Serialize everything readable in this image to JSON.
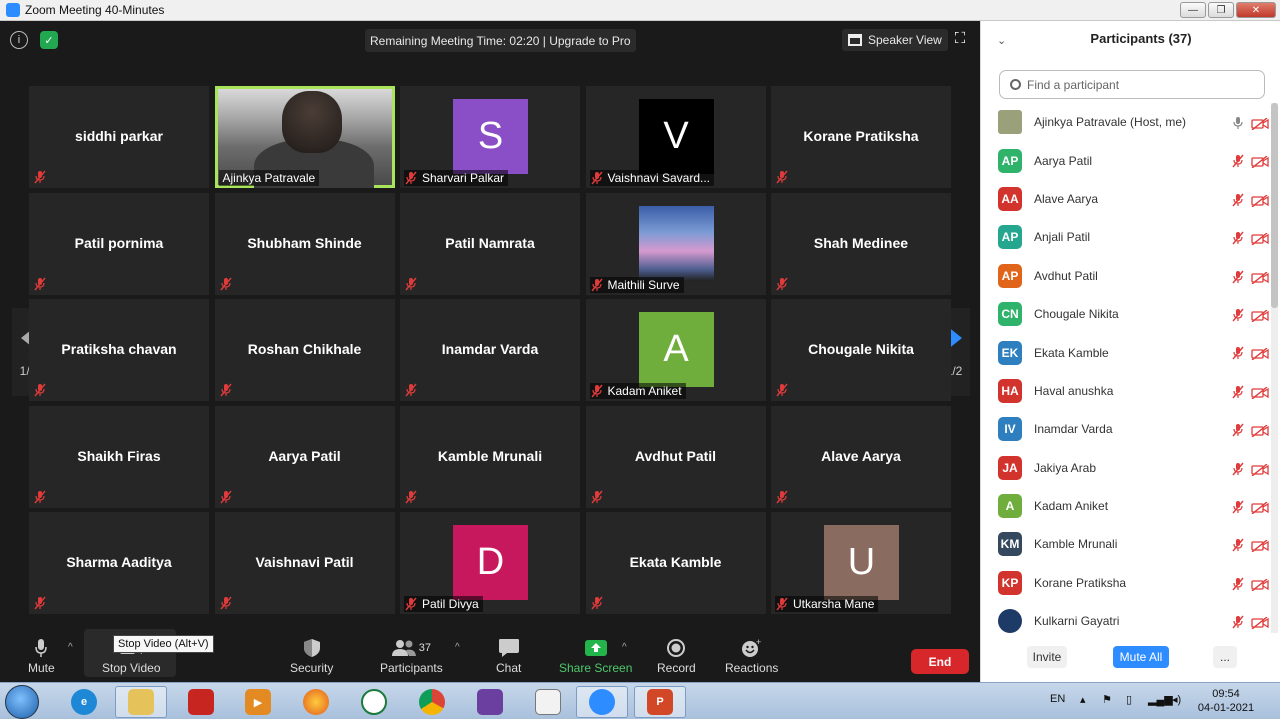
{
  "window": {
    "title": "Zoom Meeting 40-Minutes",
    "minimize": "—",
    "maximize": "❐",
    "close": "✕"
  },
  "topbar": {
    "remaining": "Remaining Meeting Time: 02:20 | Upgrade to Pro",
    "speaker_view": "Speaker View"
  },
  "pager": {
    "left": "1/2",
    "right": "1/2"
  },
  "tiles": [
    {
      "name": "siddhi parkar",
      "type": "name"
    },
    {
      "name": "Ajinkya Patravale",
      "type": "video"
    },
    {
      "name": "Sharvari Palkar",
      "type": "avatar",
      "letter": "S",
      "color": "#8a4fc7"
    },
    {
      "name": "Vaishnavi Savard...",
      "type": "avatar",
      "letter": "V",
      "color": "#000000"
    },
    {
      "name": "Korane Pratiksha",
      "type": "name"
    },
    {
      "name": "Patil pornima",
      "type": "name"
    },
    {
      "name": "Shubham Shinde",
      "type": "name"
    },
    {
      "name": "Patil Namrata",
      "type": "name"
    },
    {
      "name": "Maithili Surve",
      "type": "sky"
    },
    {
      "name": "Shah Medinee",
      "type": "name"
    },
    {
      "name": "Pratiksha chavan",
      "type": "name"
    },
    {
      "name": "Roshan Chikhale",
      "type": "name"
    },
    {
      "name": "Inamdar Varda",
      "type": "name"
    },
    {
      "name": "Kadam Aniket",
      "type": "avatar",
      "letter": "A",
      "color": "#6fae3c"
    },
    {
      "name": "Chougale Nikita",
      "type": "name"
    },
    {
      "name": "Shaikh Firas",
      "type": "name"
    },
    {
      "name": "Aarya Patil",
      "type": "name"
    },
    {
      "name": "Kamble Mrunali",
      "type": "name"
    },
    {
      "name": "Avdhut Patil",
      "type": "name"
    },
    {
      "name": "Alave Aarya",
      "type": "name"
    },
    {
      "name": "Sharma Aaditya",
      "type": "name"
    },
    {
      "name": "Vaishnavi Patil",
      "type": "name"
    },
    {
      "name": "Patil Divya",
      "type": "avatar",
      "letter": "D",
      "color": "#c8185d"
    },
    {
      "name": "Ekata Kamble",
      "type": "name"
    },
    {
      "name": "Utkarsha Mane",
      "type": "avatar",
      "letter": "U",
      "color": "#8a6b5f"
    }
  ],
  "toolbar": {
    "mute": "Mute",
    "stop_video": "Stop Video",
    "tooltip": "Stop Video (Alt+V)",
    "security": "Security",
    "participants": "Participants",
    "participants_count": "37",
    "chat": "Chat",
    "share_screen": "Share Screen",
    "record": "Record",
    "reactions": "Reactions",
    "end": "End"
  },
  "panel": {
    "title": "Participants (37)",
    "search_placeholder": "Find a participant",
    "participants": [
      {
        "name": "Ajinkya Patravale (Host, me)",
        "initials": "",
        "color": "#9aa07a"
      },
      {
        "name": "Aarya Patil",
        "initials": "AP",
        "color": "#2fb36b"
      },
      {
        "name": "Alave Aarya",
        "initials": "AA",
        "color": "#d2342d"
      },
      {
        "name": "Anjali Patil",
        "initials": "AP",
        "color": "#25a68f"
      },
      {
        "name": "Avdhut Patil",
        "initials": "AP",
        "color": "#e0651b"
      },
      {
        "name": "Chougale Nikita",
        "initials": "CN",
        "color": "#2fb36b"
      },
      {
        "name": "Ekata Kamble",
        "initials": "EK",
        "color": "#2d7fbf"
      },
      {
        "name": "Haval anushka",
        "initials": "HA",
        "color": "#d2342d"
      },
      {
        "name": "Inamdar Varda",
        "initials": "IV",
        "color": "#2d7fbf"
      },
      {
        "name": "Jakiya Arab",
        "initials": "JA",
        "color": "#d2342d"
      },
      {
        "name": "Kadam Aniket",
        "initials": "A",
        "color": "#6fae3c"
      },
      {
        "name": "Kamble Mrunali",
        "initials": "KM",
        "color": "#34495e"
      },
      {
        "name": "Korane Pratiksha",
        "initials": "KP",
        "color": "#d2342d"
      },
      {
        "name": "Kulkarni Gayatri",
        "initials": "",
        "color": "#1e3a66"
      }
    ],
    "invite": "Invite",
    "mute_all": "Mute All",
    "more": "..."
  },
  "taskbar": {
    "lang": "EN",
    "time": "09:54",
    "date": "04-01-2021"
  }
}
